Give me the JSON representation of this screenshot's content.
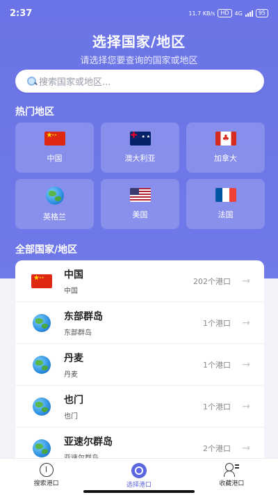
{
  "status": {
    "time": "2:37",
    "net_speed": "11.7 KB/s",
    "hd": "HD",
    "network": "4G",
    "battery": "95"
  },
  "header": {
    "title": "选择国家/地区",
    "subtitle": "请选择您要查询的国家或地区"
  },
  "search": {
    "placeholder": "搜索国家或地区..."
  },
  "hot": {
    "label": "热门地区",
    "items": [
      {
        "name": "中国",
        "flag": "flag-cn"
      },
      {
        "name": "澳大利亚",
        "flag": "flag-au"
      },
      {
        "name": "加拿大",
        "flag": "flag-ca"
      },
      {
        "name": "英格兰",
        "flag": "globe"
      },
      {
        "name": "美国",
        "flag": "flag-us"
      },
      {
        "name": "法国",
        "flag": "flag-fr"
      }
    ]
  },
  "all": {
    "label": "全部国家/地区",
    "items": [
      {
        "name": "中国",
        "sub": "中国",
        "count": "202个港口",
        "flag": "flag-cn"
      },
      {
        "name": "东部群岛",
        "sub": "东部群岛",
        "count": "1个港口",
        "flag": "globe"
      },
      {
        "name": "丹麦",
        "sub": "丹麦",
        "count": "1个港口",
        "flag": "globe"
      },
      {
        "name": "也门",
        "sub": "也门",
        "count": "1个港口",
        "flag": "globe"
      },
      {
        "name": "亚速尔群岛",
        "sub": "亚速尔群岛",
        "count": "2个港口",
        "flag": "globe"
      }
    ],
    "arrow": "→"
  },
  "tabs": [
    {
      "label": "搜索港口",
      "icon": "search-port-icon",
      "active": false
    },
    {
      "label": "选择港口",
      "icon": "select-port-icon",
      "active": true
    },
    {
      "label": "收藏港口",
      "icon": "favorite-port-icon",
      "active": false
    }
  ],
  "colors": {
    "primary": "#6b74e6",
    "active_tab": "#5b66e0"
  }
}
